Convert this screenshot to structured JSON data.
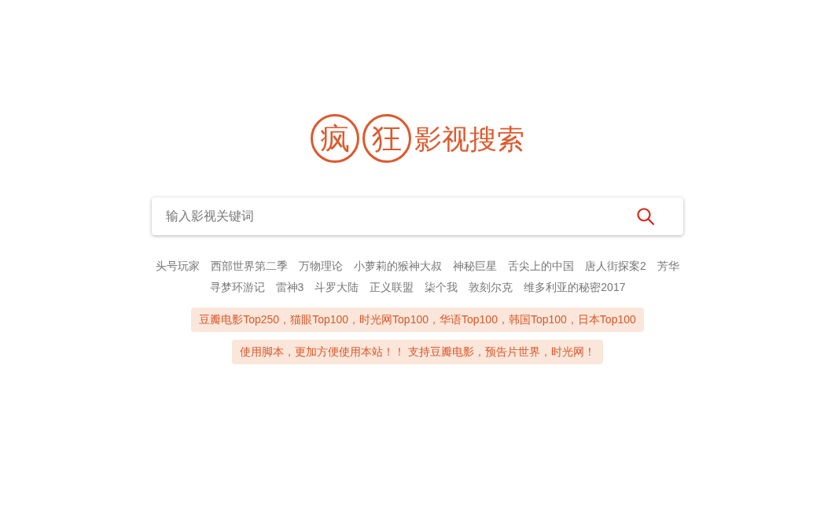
{
  "logo": {
    "circled": [
      "疯",
      "狂"
    ],
    "text": "影视搜索"
  },
  "search": {
    "placeholder": "输入影视关键词"
  },
  "hot_keywords": [
    "头号玩家",
    "西部世界第二季",
    "万物理论",
    "小萝莉的猴神大叔",
    "神秘巨星",
    "舌尖上的中国",
    "唐人街探案2",
    "芳华",
    "寻梦环游记",
    "雷神3",
    "斗罗大陆",
    "正义联盟",
    "柒个我",
    "敦刻尔克",
    "维多利亚的秘密2017"
  ],
  "notices": [
    "豆瓣电影Top250，猫眼Top100，时光网Top100，华语Top100，韩国Top100，日本Top100",
    "使用脚本，更加方便使用本站！！ 支持豆瓣电影，预告片世界，时光网！"
  ]
}
